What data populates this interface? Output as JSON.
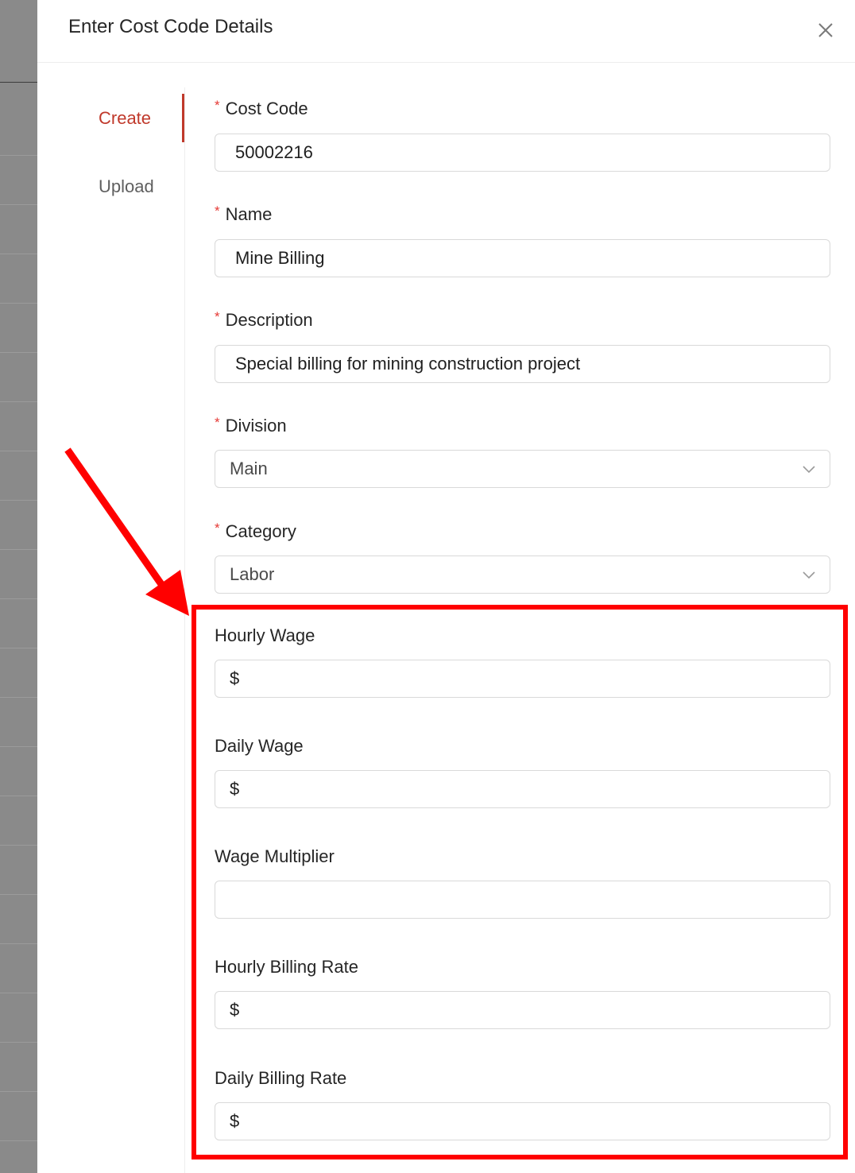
{
  "drawer": {
    "title": "Enter Cost Code Details"
  },
  "tabs": [
    {
      "label": "Create",
      "active": true
    },
    {
      "label": "Upload",
      "active": false
    }
  ],
  "form": {
    "required_mark": "*",
    "cost_code": {
      "label": "Cost Code",
      "value": "50002216"
    },
    "name": {
      "label": "Name",
      "value": "Mine Billing"
    },
    "description": {
      "label": "Description",
      "value": "Special billing for mining construction project"
    },
    "division": {
      "label": "Division",
      "value": "Main"
    },
    "category": {
      "label": "Category",
      "value": "Labor"
    },
    "hourly_wage": {
      "label": "Hourly Wage",
      "prefix": "$",
      "value": ""
    },
    "daily_wage": {
      "label": "Daily Wage",
      "prefix": "$",
      "value": ""
    },
    "wage_multiplier": {
      "label": "Wage Multiplier",
      "value": ""
    },
    "hourly_billing_rate": {
      "label": "Hourly Billing Rate",
      "prefix": "$",
      "value": ""
    },
    "daily_billing_rate": {
      "label": "Daily Billing Rate",
      "prefix": "$",
      "value": ""
    }
  },
  "colors": {
    "accent": "#c0392b",
    "required": "#e53935",
    "annotation": "#ff0000"
  },
  "icons": {
    "close": "close-icon",
    "dropdown": "chevron-down-icon"
  }
}
